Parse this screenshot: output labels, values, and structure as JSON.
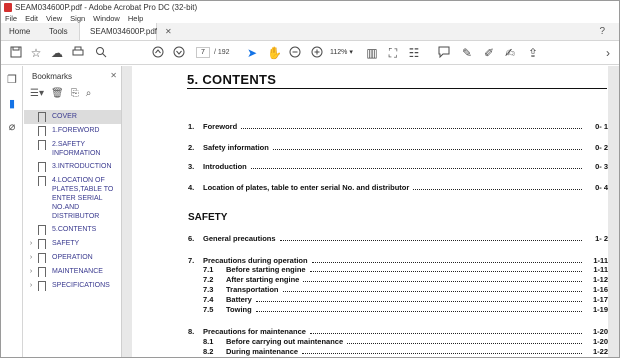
{
  "window": {
    "title": "SEAM034600P.pdf - Adobe Acrobat Pro DC (32-bit)"
  },
  "menu": [
    "File",
    "Edit",
    "View",
    "Sign",
    "Window",
    "Help"
  ],
  "tabs": {
    "home": "Home",
    "tools": "Tools",
    "doc": "SEAM034600P.pdf"
  },
  "toolbar": {
    "page_current": "7",
    "page_total": "/ 192",
    "zoom": "112%"
  },
  "bookmarks": {
    "header": "Bookmarks",
    "items": [
      {
        "label": "COVER",
        "selected": true
      },
      {
        "label": "1.FOREWORD"
      },
      {
        "label": "2.SAFETY INFORMATION"
      },
      {
        "label": "3.INTRODUCTION"
      },
      {
        "label": "4.LOCATION OF PLATES,TABLE TO ENTER SERIAL NO.AND DISTRIBUTOR"
      },
      {
        "label": "5.CONTENTS"
      },
      {
        "label": "SAFETY",
        "expandable": true
      },
      {
        "label": "OPERATION",
        "expandable": true
      },
      {
        "label": "MAINTENANCE",
        "expandable": true
      },
      {
        "label": "SPECIFICATIONS",
        "expandable": true
      }
    ]
  },
  "document": {
    "heading": "5. CONTENTS",
    "section_safety": "SAFETY",
    "entries": [
      {
        "num": "1.",
        "title": "Foreword",
        "page": "0- 1"
      },
      {
        "num": "2.",
        "title": "Safety information",
        "page": "0- 2"
      },
      {
        "num": "3.",
        "title": "Introduction",
        "page": "0- 3"
      },
      {
        "num": "4.",
        "title": "Location of plates, table to enter serial No. and distributor",
        "page": "0- 4"
      }
    ],
    "safety_entries": [
      {
        "num": "6.",
        "title": "General precautions",
        "page": "1- 2"
      },
      {
        "num": "7.",
        "title": "Precautions during operation",
        "page": "1-11"
      },
      {
        "sub": "7.1",
        "title": "Before starting engine",
        "page": "1-11"
      },
      {
        "sub": "7.2",
        "title": "After starting engine",
        "page": "1-12"
      },
      {
        "sub": "7.3",
        "title": "Transportation",
        "page": "1-16"
      },
      {
        "sub": "7.4",
        "title": "Battery",
        "page": "1-17"
      },
      {
        "sub": "7.5",
        "title": "Towing",
        "page": "1-19"
      },
      {
        "num": "8.",
        "title": "Precautions for maintenance",
        "page": "1-20"
      },
      {
        "sub": "8.1",
        "title": "Before carrying out maintenance",
        "page": "1-20"
      },
      {
        "sub": "8.2",
        "title": "During maintenance",
        "page": "1-22"
      }
    ]
  }
}
